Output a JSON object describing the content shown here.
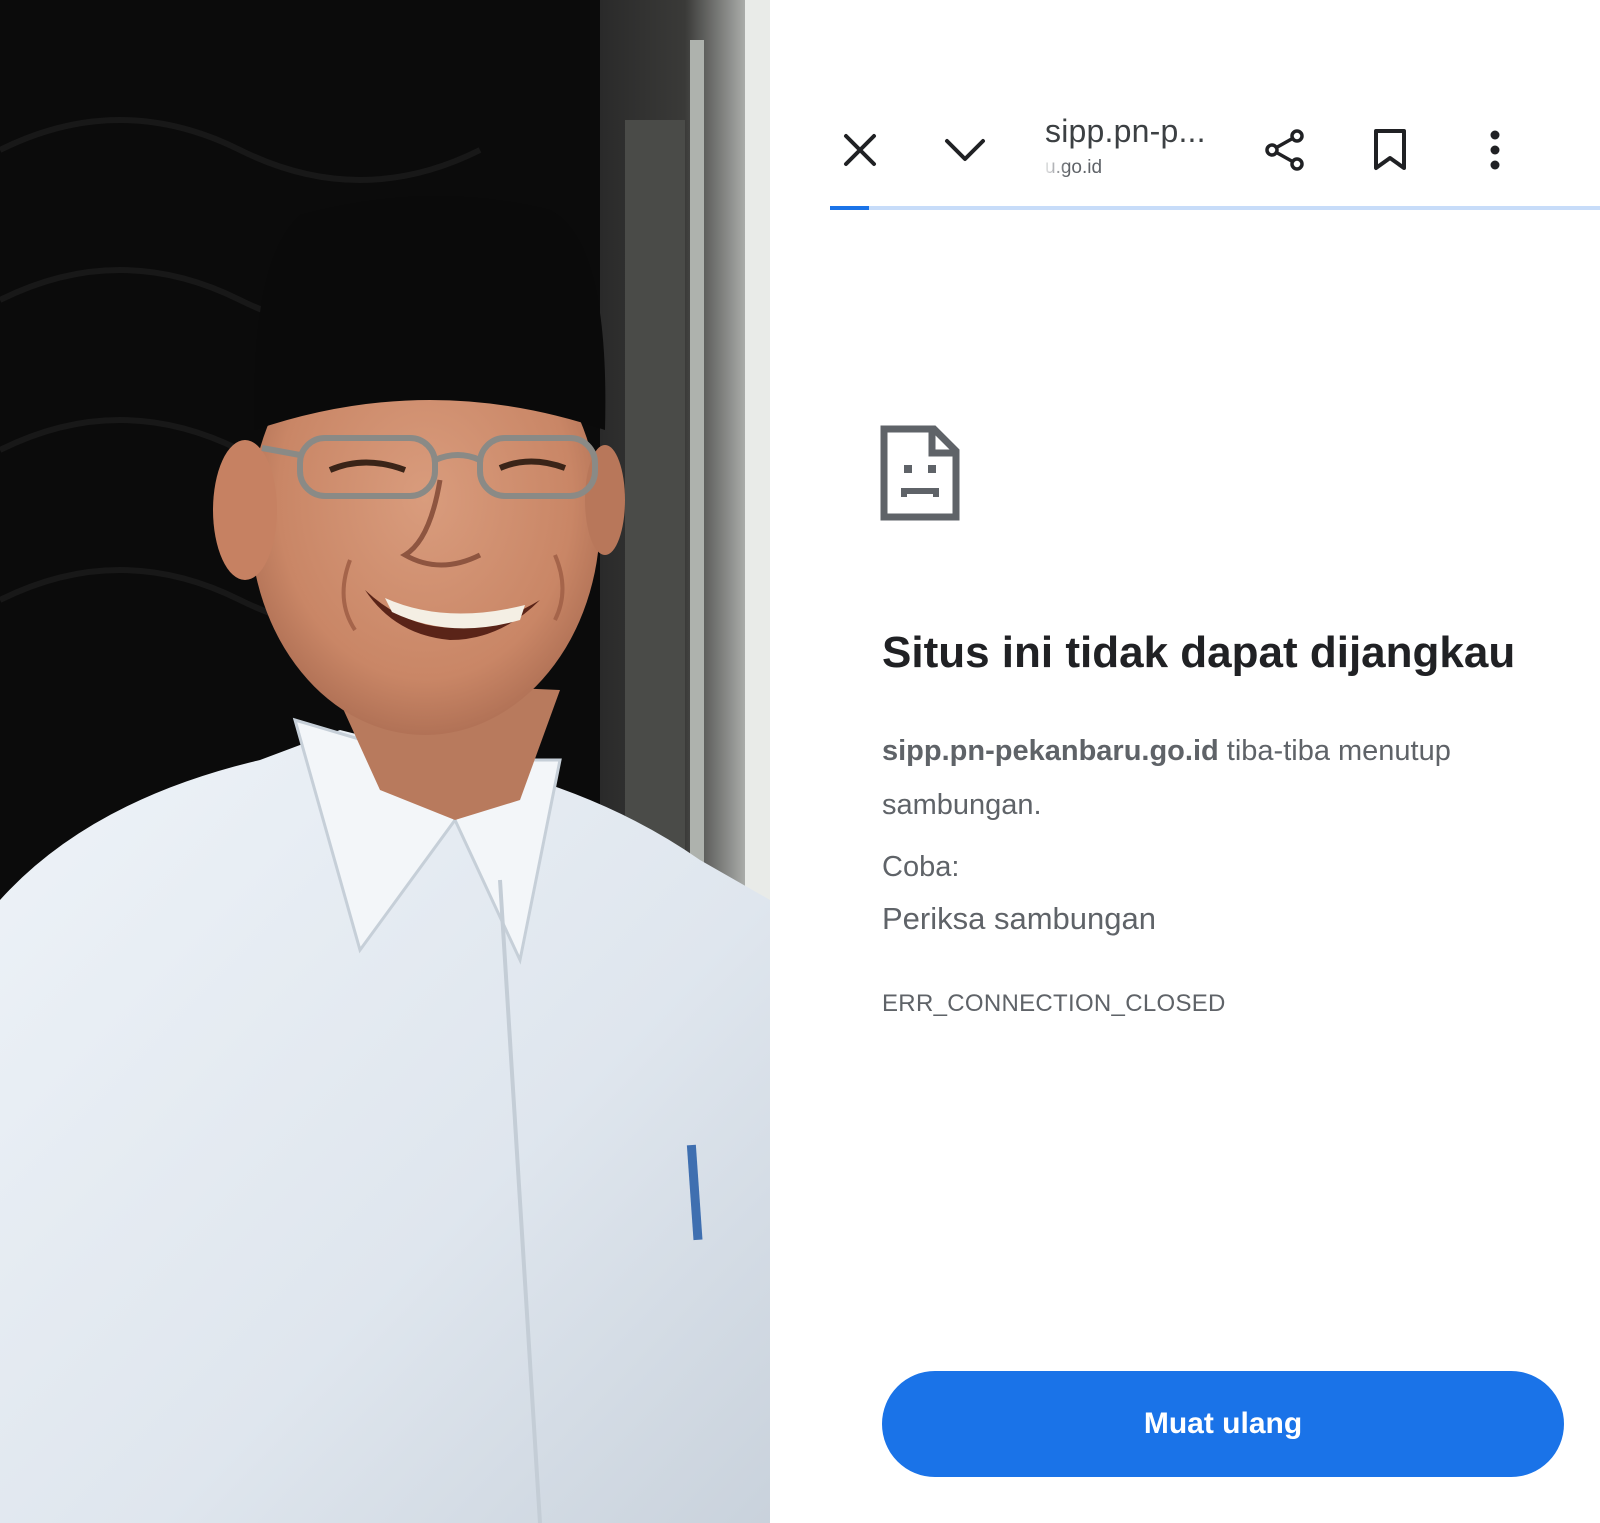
{
  "browser": {
    "toolbar": {
      "close_icon": "close-icon",
      "collapse_icon": "chevron-down-icon",
      "url_title": "sipp.pn-p...",
      "url_subtitle": "u.go.id",
      "share_icon": "share-icon",
      "bookmark_icon": "bookmark-icon",
      "menu_icon": "more-vert-icon"
    },
    "progress": 0.05,
    "accent_color": "#1a73e8"
  },
  "error_page": {
    "icon": "sad-page-icon",
    "title": "Situs ini tidak dapat dijangkau",
    "host": "sipp.pn-pekanbaru.go.id",
    "message_rest": " tiba-tiba menutup sambungan.",
    "try_label": "Coba:",
    "suggestion": "Periksa sambungan",
    "error_code": "ERR_CONNECTION_CLOSED",
    "reload_label": "Muat ulang"
  },
  "photo": {
    "description_icon": "portrait-photo"
  }
}
